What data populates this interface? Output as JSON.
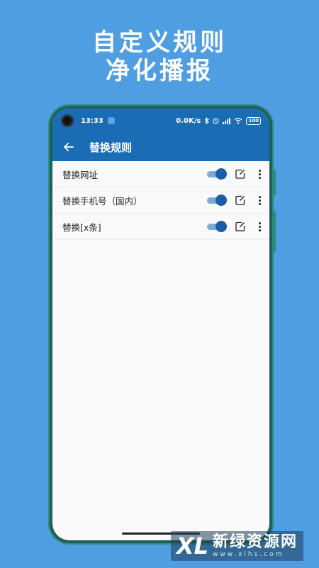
{
  "promo": {
    "title_line1": "自定义规则",
    "title_line2": "净化播报"
  },
  "statusbar": {
    "time": "13:33",
    "network_speed": "0.0K/s",
    "battery": "100"
  },
  "appbar": {
    "back_icon": "arrow-left-icon",
    "title": "替换规则"
  },
  "rules": [
    {
      "label": "替换网址",
      "enabled": true
    },
    {
      "label": "替换手机号（国内）",
      "enabled": true
    },
    {
      "label": "替换[x条]",
      "enabled": true
    }
  ],
  "watermark": {
    "logo": "XL",
    "name": "新绿资源网",
    "url": "www.xlhs.com"
  },
  "colors": {
    "background": "#4f9ee2",
    "primary": "#1a6cb5",
    "toggle_thumb": "#1a5fa6",
    "toggle_track": "#7fa9d3"
  }
}
